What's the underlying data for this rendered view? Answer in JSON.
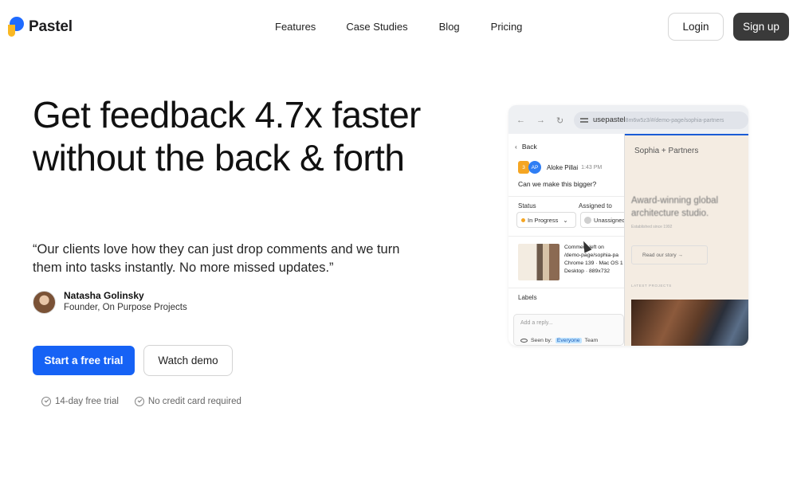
{
  "brand": {
    "name": "Pastel",
    "colors": {
      "blue": "#1f6bff",
      "yellow": "#f9b824",
      "primary": "#1662f5",
      "dark": "#3a3a3a"
    }
  },
  "nav": {
    "links": [
      "Features",
      "Case Studies",
      "Blog",
      "Pricing"
    ],
    "login": "Login",
    "signup": "Sign up"
  },
  "hero": {
    "headline": "Get feedback 4.7x faster without the back & forth",
    "quote": "“Our clients love how they can just drop comments and we turn them into tasks instantly. No more missed updates.”",
    "author": {
      "name": "Natasha Golinsky",
      "role": "Founder, On Purpose Projects"
    },
    "cta_primary": "Start a free trial",
    "cta_secondary": "Watch demo",
    "perks": [
      "14-day free trial",
      "No credit card required"
    ]
  },
  "mockup": {
    "url": "usepastel",
    "url_rest": "8m6w5z3/#/demo-page/sophia-partners",
    "back": "Back",
    "comment": {
      "badge_num": "3",
      "initials": "AP",
      "name": "Aloke Pillai",
      "time": "1:43 PM",
      "body": "Can we make this bigger?"
    },
    "status_label": "Status",
    "status_value": "In Progress",
    "assigned_label": "Assigned to",
    "assigned_value": "Unassigned",
    "meta_lines": [
      "Comment left on",
      "/demo-page/sophia-pa",
      "Chrome 139 · Mac OS 1",
      "Desktop · 889x732"
    ],
    "labels": "Labels",
    "reply_placeholder": "Add a reply...",
    "seen_by": "Seen by:",
    "seen_everyone": "Everyone",
    "seen_team": "Team",
    "site": {
      "brand": "Sophia + Partners",
      "headline": "Award-winning global architecture studio.",
      "sub": "Established since 1992",
      "button": "Read our story →",
      "latest": "LATEST PROJECTS"
    }
  }
}
